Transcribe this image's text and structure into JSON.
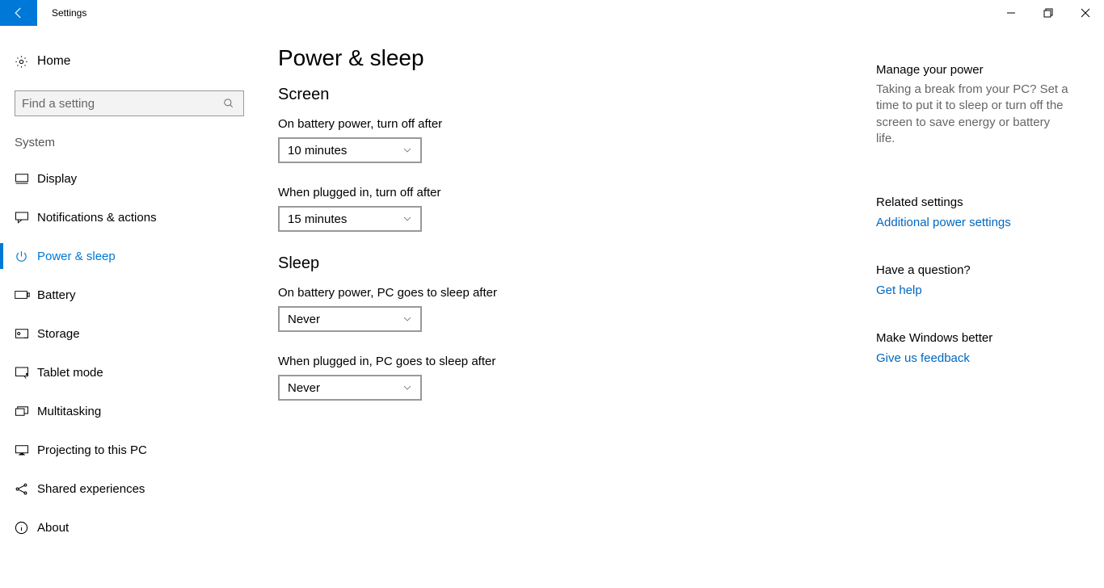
{
  "titlebar": {
    "title": "Settings"
  },
  "sidebar": {
    "home_label": "Home",
    "search_placeholder": "Find a setting",
    "category": "System",
    "items": [
      {
        "label": "Display"
      },
      {
        "label": "Notifications & actions"
      },
      {
        "label": "Power & sleep"
      },
      {
        "label": "Battery"
      },
      {
        "label": "Storage"
      },
      {
        "label": "Tablet mode"
      },
      {
        "label": "Multitasking"
      },
      {
        "label": "Projecting to this PC"
      },
      {
        "label": "Shared experiences"
      },
      {
        "label": "About"
      }
    ]
  },
  "main": {
    "title": "Power & sleep",
    "screen": {
      "heading": "Screen",
      "battery_label": "On battery power, turn off after",
      "battery_value": "10 minutes",
      "plugged_label": "When plugged in, turn off after",
      "plugged_value": "15 minutes"
    },
    "sleep": {
      "heading": "Sleep",
      "battery_label": "On battery power, PC goes to sleep after",
      "battery_value": "Never",
      "plugged_label": "When plugged in, PC goes to sleep after",
      "plugged_value": "Never"
    }
  },
  "right": {
    "manage_heading": "Manage your power",
    "manage_text": "Taking a break from your PC? Set a time to put it to sleep or turn off the screen to save energy or battery life.",
    "related_heading": "Related settings",
    "related_link": "Additional power settings",
    "question_heading": "Have a question?",
    "question_link": "Get help",
    "better_heading": "Make Windows better",
    "better_link": "Give us feedback"
  }
}
